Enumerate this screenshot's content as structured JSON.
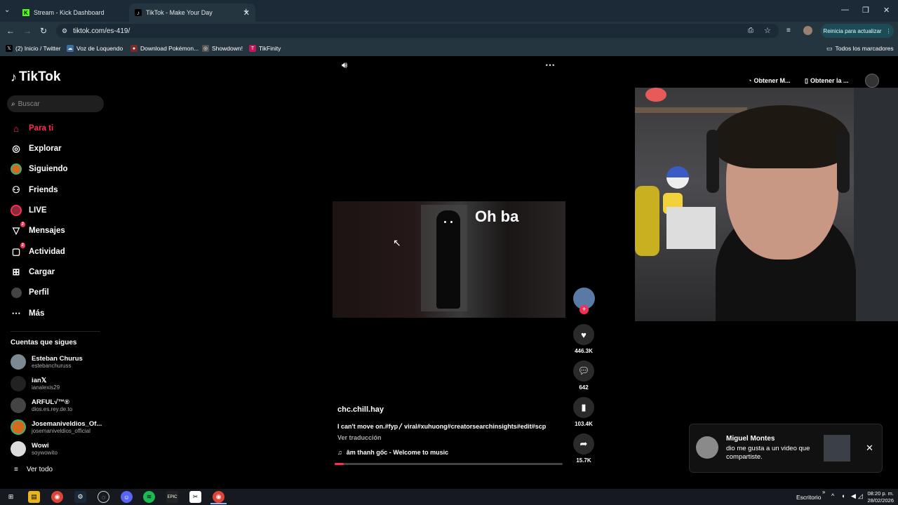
{
  "browser": {
    "tabs": [
      {
        "title": "Stream - Kick Dashboard",
        "active": false
      },
      {
        "title": "TikTok - Make Your Day",
        "active": true
      }
    ],
    "url": "tiktok.com/es-419/",
    "restart_button": "Reinicia para actualizar",
    "bookmarks": [
      "(2) Inicio / Twitter",
      "Voz de Loquendo",
      "Download Pokémon...",
      "Showdown!",
      "TikFinity"
    ],
    "all_bookmarks": "Todos los marcadores"
  },
  "tiktok": {
    "logo": "TikTok",
    "search_placeholder": "Buscar",
    "nav": [
      {
        "label": "Para ti",
        "icon": "home-icon",
        "active": true
      },
      {
        "label": "Explorar",
        "icon": "compass-icon"
      },
      {
        "label": "Siguiendo",
        "icon": "following-icon"
      },
      {
        "label": "Friends",
        "icon": "friends-icon"
      },
      {
        "label": "LIVE",
        "icon": "live-icon"
      },
      {
        "label": "Mensajes",
        "icon": "messages-icon",
        "badge": "2"
      },
      {
        "label": "Actividad",
        "icon": "activity-icon",
        "badge": "2"
      },
      {
        "label": "Cargar",
        "icon": "upload-icon"
      },
      {
        "label": "Perfil",
        "icon": "profile-icon"
      },
      {
        "label": "Más",
        "icon": "more-icon"
      }
    ],
    "following_heading": "Cuentas que sigues",
    "accounts": [
      {
        "name": "Esteban Churus",
        "handle": "estebanchuruss"
      },
      {
        "name": "ian𝕏",
        "handle": "ianalexis29"
      },
      {
        "name": "ARFUL√™®",
        "handle": "dios.es.rey.de.to"
      },
      {
        "name": "Josemaniveldios_Of...",
        "handle": "josemaniveldios_official"
      },
      {
        "name": "Wowi",
        "handle": "soywowito"
      }
    ],
    "see_all": "Ver todo",
    "video": {
      "overlay_text": "Oh ba",
      "author": "chc.chill.hay",
      "caption": "I can't move on.#fyp〳viral#xuhuong#creatorsearchinsights#edit#scp",
      "translate": "Ver traducción",
      "music": "âm thanh gốc - Welcome to music",
      "likes": "446.3K",
      "comments": "642",
      "saves": "103.4K",
      "shares": "15.7K",
      "progress": 0.04
    },
    "top_buttons": [
      "Obtener M...",
      "Obtener la ..."
    ]
  },
  "notification": {
    "name": "Miguel Montes",
    "text": "dio me gusta a un video que compartiste."
  },
  "taskbar": {
    "desktop": "Escritorio",
    "time": "08:20 p. m.",
    "date": "28/02/2026"
  },
  "colors": {
    "accent": "#fe2c55",
    "chrome_bg": "#1b2a36"
  }
}
